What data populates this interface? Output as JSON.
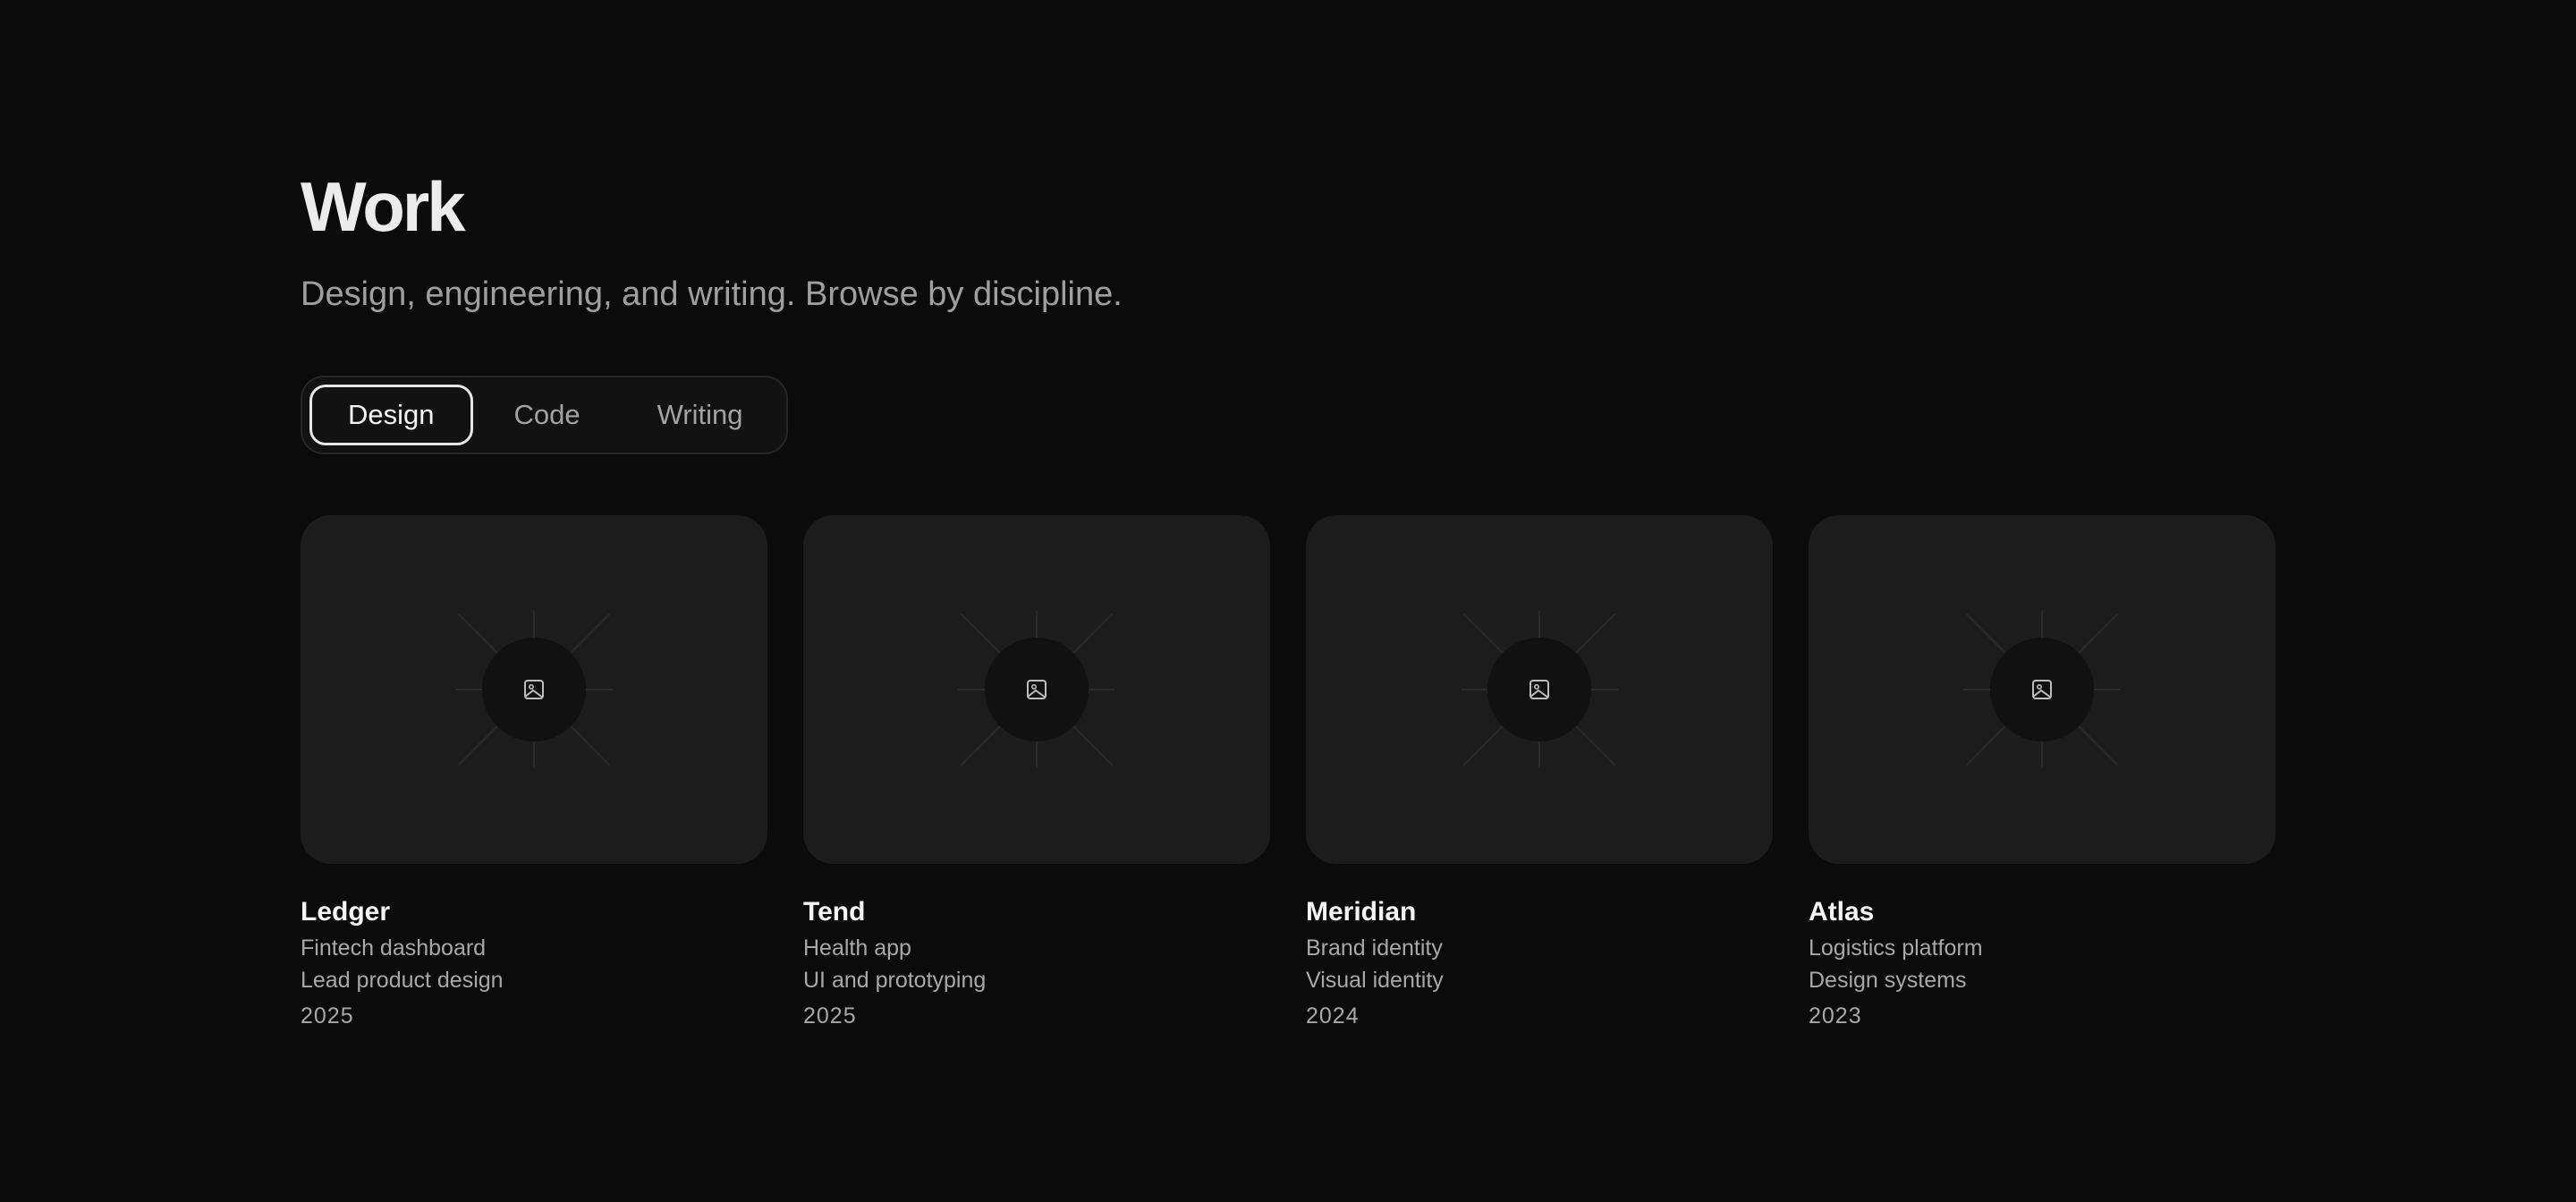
{
  "header": {
    "title": "Work",
    "subtitle": "Design, engineering, and writing. Browse by discipline."
  },
  "tabs": [
    {
      "label": "Design",
      "active": true
    },
    {
      "label": "Code",
      "active": false
    },
    {
      "label": "Writing",
      "active": false
    }
  ],
  "projects": [
    {
      "title": "Ledger",
      "category": "Fintech dashboard",
      "role": "Lead product design",
      "year": "2025",
      "thumbnail_icon": "image-icon"
    },
    {
      "title": "Tend",
      "category": "Health app",
      "role": "UI and prototyping",
      "year": "2025",
      "thumbnail_icon": "image-icon"
    },
    {
      "title": "Meridian",
      "category": "Brand identity",
      "role": "Visual identity",
      "year": "2024",
      "thumbnail_icon": "image-icon"
    },
    {
      "title": "Atlas",
      "category": "Logistics platform",
      "role": "Design systems",
      "year": "2023",
      "thumbnail_icon": "image-icon"
    }
  ],
  "colors": {
    "background": "#0b0b0b",
    "card": "#1c1c1c",
    "text": "#ececec",
    "muted": "#a8a8a8"
  }
}
